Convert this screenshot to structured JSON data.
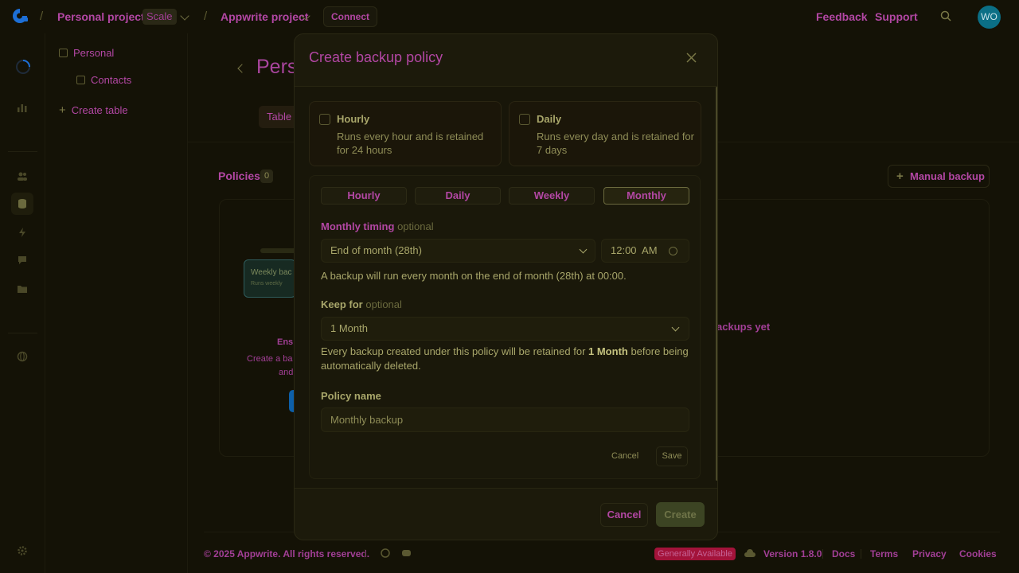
{
  "topbar": {
    "org": "Personal projects",
    "plan": "Scale",
    "project": "Appwrite project",
    "connect": "Connect",
    "feedback": "Feedback",
    "support": "Support",
    "avatar": "WO"
  },
  "sidebar": {
    "database": "Personal",
    "table": "Contacts",
    "create_table": "Create table"
  },
  "main": {
    "title": "Pers",
    "tab": "Table",
    "policies_label": "Policies",
    "policies_count": "0",
    "manual_backup": "Manual backup",
    "empty_yet": "ackups yet",
    "illus_title": "Weekly bac",
    "illus_sub": "Runs weekly",
    "empty_line1": "Ens",
    "empty_line2": "Create a ba",
    "empty_line3": "and"
  },
  "modal": {
    "title": "Create backup policy",
    "presets": [
      {
        "title": "Hourly",
        "desc": "Runs every hour and is retained for 24 hours"
      },
      {
        "title": "Daily",
        "desc": "Runs every day and is retained for 7 days"
      }
    ],
    "segments": [
      "Hourly",
      "Daily",
      "Weekly",
      "Monthly"
    ],
    "timing_label": "Monthly timing",
    "optional": "optional",
    "timing_value": "End of month (28th)",
    "time_value": "12:00  AM",
    "timing_help": "A backup will run every month on the end of month (28th) at 00:00.",
    "keep_label": "Keep for",
    "keep_value": "1 Month",
    "keep_help_pre": "Every backup created under this policy will be retained for ",
    "keep_help_bold": "1 Month",
    "keep_help_post": " before being automatically deleted.",
    "name_label": "Policy name",
    "name_value": "Monthly backup",
    "inner_cancel": "Cancel",
    "inner_save": "Save",
    "cancel": "Cancel",
    "create": "Create"
  },
  "footer": {
    "copyright": "© 2025 Appwrite. All rights reserved.",
    "status": "Generally Available",
    "version": "Version 1.8.0",
    "docs": "Docs",
    "terms": "Terms",
    "privacy": "Privacy",
    "cookies": "Cookies"
  }
}
